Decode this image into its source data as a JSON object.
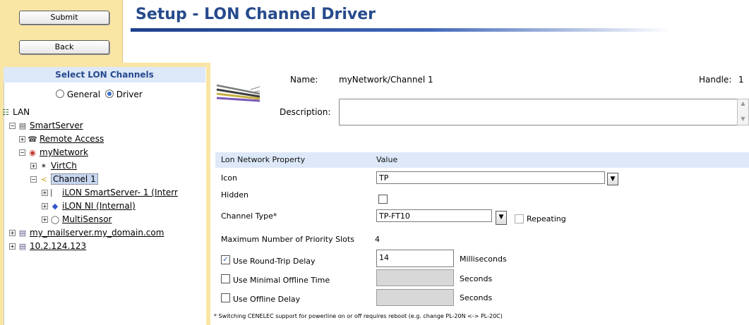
{
  "header": {
    "submit_label": "Submit",
    "back_label": "Back",
    "title": "Setup - LON Channel Driver"
  },
  "sidebar": {
    "heading": "Select LON Channels",
    "mode_general": "General",
    "mode_driver": "Driver",
    "mode_selected": "Driver",
    "tree": {
      "lan": "LAN",
      "smartserver": "SmartServer",
      "remote_access": "Remote Access",
      "mynetwork": "myNetwork",
      "virtch": "VirtCh",
      "channel1": "Channel 1",
      "ilon_smartserver": "iLON SmartServer- 1 (Interr",
      "ilon_ni": "iLON NI (Internal)",
      "multisensor": "MultiSensor",
      "mailserver": "my_mailserver.my_domain.com",
      "ip": "10.2.124.123"
    }
  },
  "details": {
    "name_label": "Name:",
    "name_value": "myNetwork/Channel 1",
    "handle_label": "Handle:",
    "handle_value": "1",
    "description_label": "Description:",
    "description_value": ""
  },
  "table": {
    "col_property": "Lon Network Property",
    "col_value": "Value",
    "icon_label": "Icon",
    "icon_value": "TP",
    "hidden_label": "Hidden",
    "hidden_checked": false,
    "channel_type_label": "Channel Type*",
    "channel_type_value": "TP-FT10",
    "repeating_label": "Repeating",
    "repeating_checked": false,
    "priority_label": "Maximum Number of Priority Slots",
    "priority_value": "4",
    "rtd_label": "Use Round-Trip Delay",
    "rtd_checked": true,
    "rtd_value": "14",
    "rtd_unit": "Milliseconds",
    "mot_label": "Use Minimal Offline Time",
    "mot_checked": false,
    "mot_value": "",
    "mot_unit": "Seconds",
    "od_label": "Use Offline Delay",
    "od_checked": false,
    "od_value": "",
    "od_unit": "Seconds"
  },
  "footnote": "* Switching CENELEC support for powerline on or off requires reboot (e.g. change PL-20N <-> PL-20C)",
  "colors": {
    "title": "#264a8c",
    "sidebar_bg": "#f9e5a4",
    "table_header_bg": "#dde8f8",
    "selected_bg": "#c7d7f0"
  }
}
